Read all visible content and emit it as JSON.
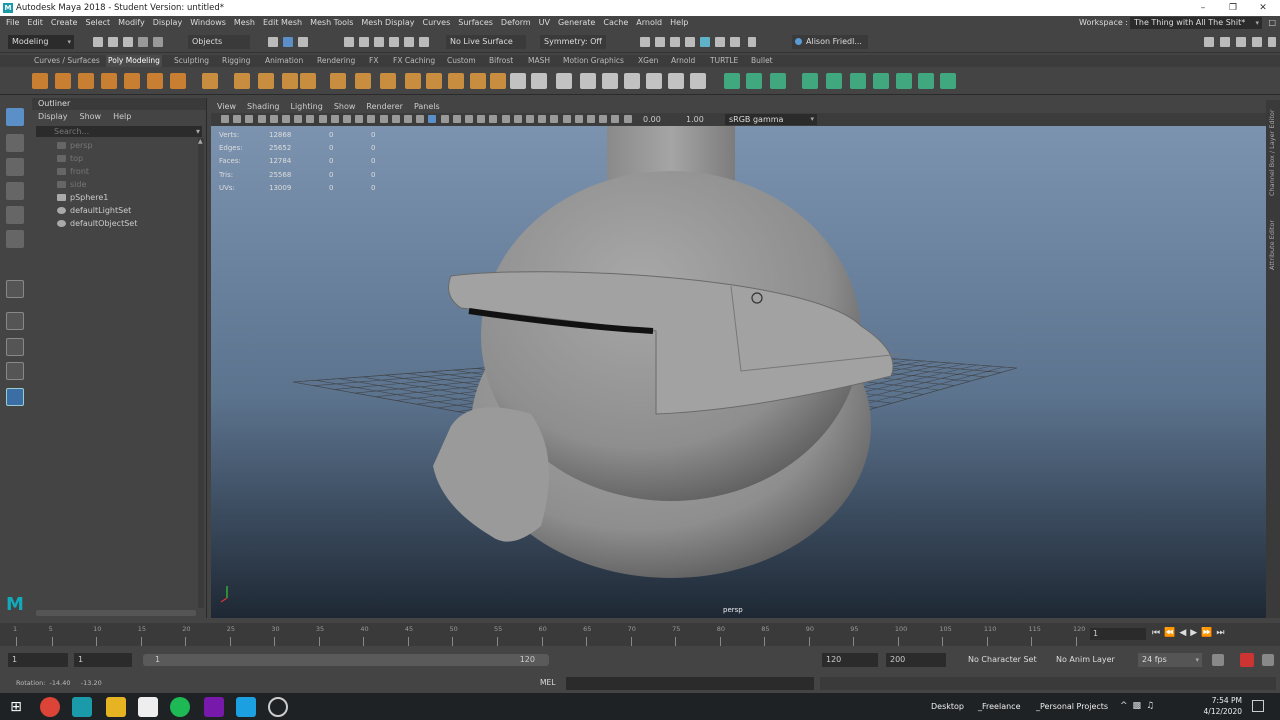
{
  "window": {
    "title": "Autodesk Maya 2018 - Student Version: untitled*",
    "app_icon_letter": "M"
  },
  "menubar": {
    "items": [
      "File",
      "Edit",
      "Create",
      "Select",
      "Modify",
      "Display",
      "Windows",
      "Mesh",
      "Edit Mesh",
      "Mesh Tools",
      "Mesh Display",
      "Curves",
      "Surfaces",
      "Deform",
      "UV",
      "Generate",
      "Cache",
      "Arnold",
      "Help"
    ],
    "workspace_label": "Workspace :",
    "workspace_value": "The Thing with All The Shit*"
  },
  "statusline": {
    "menuset": "Modeling",
    "select_mode": "Objects",
    "live_surface": "No Live Surface",
    "symmetry": "Symmetry: Off",
    "user": "Alison Friedl..."
  },
  "shelf_tabs": [
    "Curves / Surfaces",
    "Poly Modeling",
    "Sculpting",
    "Rigging",
    "Animation",
    "Rendering",
    "FX",
    "FX Caching",
    "Custom",
    "Bifrost",
    "MASH",
    "Motion Graphics",
    "XGen",
    "Arnold",
    "TURTLE",
    "Bullet"
  ],
  "shelf_active": "Poly Modeling",
  "outliner": {
    "title": "Outliner",
    "menus": [
      "Display",
      "Show",
      "Help"
    ],
    "search_placeholder": "Search...",
    "items": [
      {
        "label": "persp",
        "dim": true,
        "icon": "camera-icon"
      },
      {
        "label": "top",
        "dim": true,
        "icon": "camera-icon"
      },
      {
        "label": "front",
        "dim": true,
        "icon": "camera-icon"
      },
      {
        "label": "side",
        "dim": true,
        "icon": "camera-icon"
      },
      {
        "label": "pSphere1",
        "dim": false,
        "icon": "mesh-icon"
      },
      {
        "label": "defaultLightSet",
        "dim": false,
        "icon": "set-icon"
      },
      {
        "label": "defaultObjectSet",
        "dim": false,
        "icon": "set-icon"
      }
    ]
  },
  "viewport": {
    "menus": [
      "View",
      "Shading",
      "Lighting",
      "Show",
      "Renderer",
      "Panels"
    ],
    "near_value": "0.00",
    "far_value": "1.00",
    "color_space": "sRGB gamma",
    "camera_label": "persp",
    "hud": [
      {
        "label": "Verts:",
        "v1": "12868",
        "v2": "0",
        "v3": "0"
      },
      {
        "label": "Edges:",
        "v1": "25652",
        "v2": "0",
        "v3": "0"
      },
      {
        "label": "Faces:",
        "v1": "12784",
        "v2": "0",
        "v3": "0"
      },
      {
        "label": "Tris:",
        "v1": "25568",
        "v2": "0",
        "v3": "0"
      },
      {
        "label": "UVs:",
        "v1": "13009",
        "v2": "0",
        "v3": "0"
      }
    ]
  },
  "right_strip": {
    "labels": [
      "Channel Box / Layer Editor",
      "Attribute Editor"
    ]
  },
  "timeline": {
    "ticks": [
      "1",
      "5",
      "10",
      "15",
      "20",
      "25",
      "30",
      "35",
      "40",
      "45",
      "50",
      "55",
      "60",
      "65",
      "70",
      "75",
      "80",
      "85",
      "90",
      "95",
      "100",
      "105",
      "110",
      "115",
      "120"
    ],
    "current_frame": "1"
  },
  "range": {
    "start": "1",
    "anim_start": "1",
    "slider_start": "1",
    "slider_end": "120",
    "end": "120",
    "anim_end": "200",
    "character_set": "No Character Set",
    "anim_layer": "No Anim Layer",
    "fps": "24 fps"
  },
  "cmdline": {
    "feedback": "Rotation:  -14.40     -13.20",
    "lang": "MEL"
  },
  "taskbar": {
    "labels": [
      "Desktop",
      "_Freelance",
      "_Personal Projects"
    ],
    "time": "7:54 PM",
    "date": "4/12/2020"
  }
}
